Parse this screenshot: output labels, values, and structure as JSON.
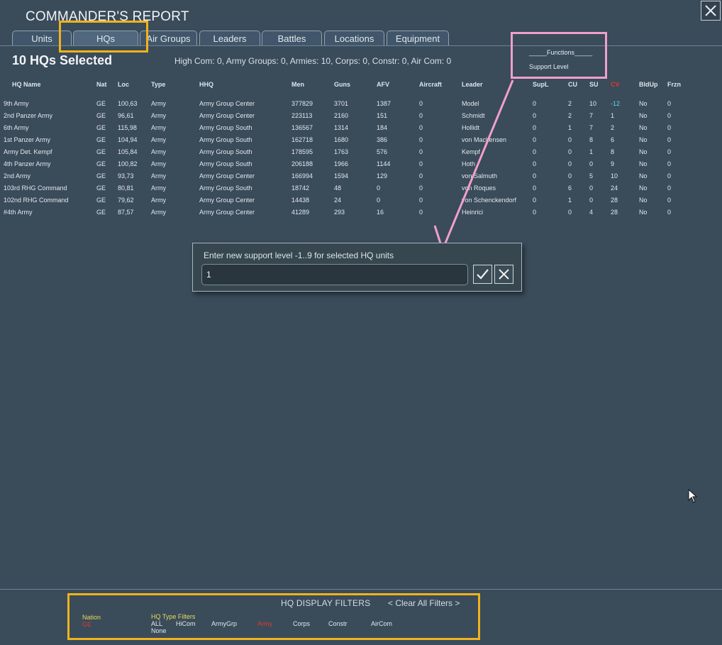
{
  "window": {
    "title": "COMMANDER'S REPORT"
  },
  "tabs": [
    {
      "label": "Units"
    },
    {
      "label": "HQs"
    },
    {
      "label": "Air Groups"
    },
    {
      "label": "Leaders"
    },
    {
      "label": "Battles"
    },
    {
      "label": "Locations"
    },
    {
      "label": "Equipment"
    }
  ],
  "active_tab": "HQs",
  "selection": {
    "count_label": "10 HQs Selected",
    "summary": "High Com: 0, Army Groups: 0, Armies: 10, Corps: 0, Constr: 0, Air Com: 0"
  },
  "functions": {
    "title": "_____Functions_____",
    "support_level": "Support Level"
  },
  "table": {
    "columns": [
      "HQ Name",
      "Nat",
      "Loc",
      "Type",
      "HHQ",
      "Men",
      "Guns",
      "AFV",
      "Aircraft",
      "Leader",
      "SupL",
      "CU",
      "SU",
      "CV",
      "BldUp",
      "Frzn"
    ],
    "rows": [
      [
        "9th Army",
        "GE",
        "100,63",
        "Army",
        "Army Group Center",
        "377829",
        "3701",
        "1387",
        "0",
        "Model",
        "0",
        "2",
        "10",
        "-12",
        "No",
        "0"
      ],
      [
        "2nd Panzer Army",
        "GE",
        "96,61",
        "Army",
        "Army Group Center",
        "223113",
        "2160",
        "151",
        "0",
        "Schmidt",
        "0",
        "2",
        "7",
        "1",
        "No",
        "0"
      ],
      [
        "6th Army",
        "GE",
        "115,98",
        "Army",
        "Army Group South",
        "136567",
        "1314",
        "184",
        "0",
        "Hollidt",
        "0",
        "1",
        "7",
        "2",
        "No",
        "0"
      ],
      [
        "1st Panzer Army",
        "GE",
        "104,94",
        "Army",
        "Army Group South",
        "162718",
        "1680",
        "386",
        "0",
        "von Mackensen",
        "0",
        "0",
        "8",
        "6",
        "No",
        "0"
      ],
      [
        "Army Det. Kempf",
        "GE",
        "105,84",
        "Army",
        "Army Group South",
        "178595",
        "1763",
        "576",
        "0",
        "Kempf",
        "0",
        "0",
        "1",
        "8",
        "No",
        "0"
      ],
      [
        "4th Panzer Army",
        "GE",
        "100,82",
        "Army",
        "Army Group South",
        "206188",
        "1966",
        "1144",
        "0",
        "Hoth",
        "0",
        "0",
        "0",
        "9",
        "No",
        "0"
      ],
      [
        "2nd Army",
        "GE",
        "93,73",
        "Army",
        "Army Group Center",
        "166994",
        "1594",
        "129",
        "0",
        "von Salmuth",
        "0",
        "0",
        "5",
        "10",
        "No",
        "0"
      ],
      [
        "103rd RHG Command",
        "GE",
        "80,81",
        "Army",
        "Army Group South",
        "18742",
        "48",
        "0",
        "0",
        "von Roques",
        "0",
        "6",
        "0",
        "24",
        "No",
        "0"
      ],
      [
        "102nd RHG Command",
        "GE",
        "79,62",
        "Army",
        "Army Group Center",
        "14438",
        "24",
        "0",
        "0",
        "von Schenckendorf",
        "0",
        "1",
        "0",
        "28",
        "No",
        "0"
      ],
      [
        "#4th Army",
        "GE",
        "87,57",
        "Army",
        "Army Group Center",
        "41289",
        "293",
        "16",
        "0",
        "Heinrici",
        "0",
        "0",
        "4",
        "28",
        "No",
        "0"
      ]
    ]
  },
  "dialog": {
    "prompt": "Enter new support level -1..9 for selected HQ units",
    "input_value": "1",
    "confirm_icon": "checkmark-icon",
    "cancel_icon": "x-icon"
  },
  "filters": {
    "title": "HQ DISPLAY FILTERS",
    "clear_label": "< Clear All Filters >",
    "nation_label": "Nation",
    "nation_value": "GE",
    "hq_type_label": "HQ  Type  Filters",
    "all_label": "ALL",
    "none_label": "None",
    "types": [
      "HiCom",
      "ArmyGrp",
      "Army",
      "Corps",
      "Constr",
      "AirCom"
    ],
    "active_type": "Army"
  },
  "colors": {
    "background": "#3a4b5a",
    "highlight_yellow": "#f0b31a",
    "annotation_pink": "#f0a0c8",
    "negative_cyan": "#63d4f2",
    "active_red": "#e0392e"
  }
}
